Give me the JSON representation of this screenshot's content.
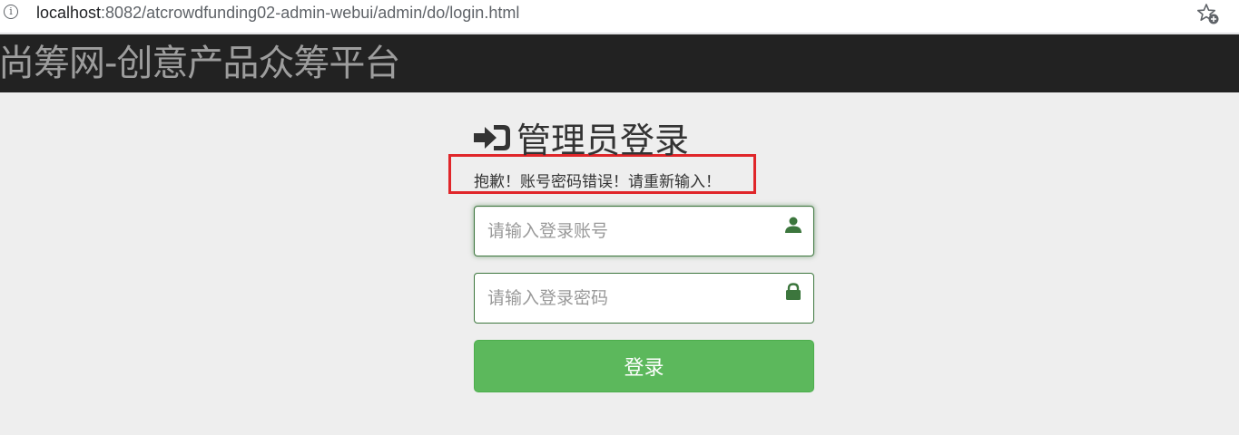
{
  "browser": {
    "url_host": "localhost",
    "url_rest": ":8082/atcrowdfunding02-admin-webui/admin/do/login.html",
    "info_glyph": "i"
  },
  "navbar": {
    "brand": "尚筹网-创意产品众筹平台"
  },
  "login": {
    "title": "管理员登录",
    "error_message": "抱歉！账号密码错误！请重新输入！",
    "account_placeholder": "请输入登录账号",
    "account_value": "",
    "password_placeholder": "请输入登录密码",
    "password_value": "",
    "submit_label": "登录"
  },
  "icons": {
    "login": "sign-in-icon",
    "account": "user-icon",
    "password": "lock-icon",
    "bookmark": "star-add-icon"
  },
  "colors": {
    "navbar_bg": "#222222",
    "brand_text": "#9d9d9d",
    "page_bg": "#eeeeee",
    "success_border": "#3c763d",
    "button_bg": "#5cb85c",
    "highlight": "#e0262a"
  }
}
